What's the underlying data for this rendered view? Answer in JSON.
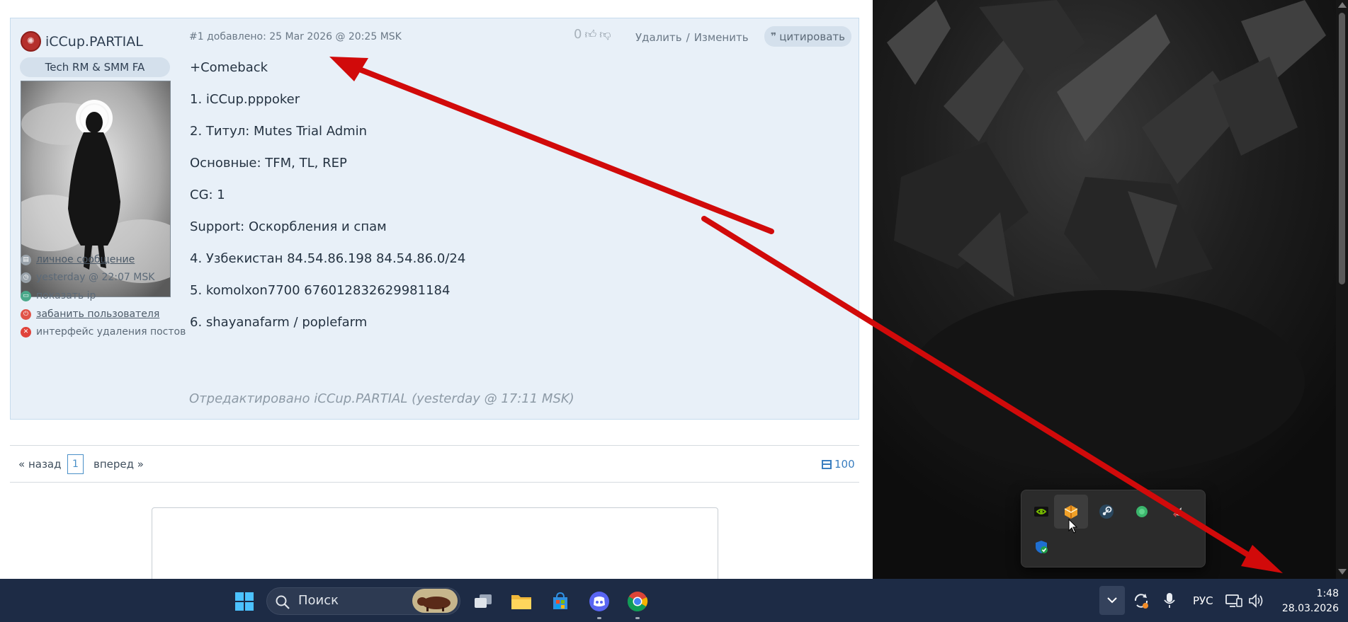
{
  "post": {
    "author": "iCCup.PARTIAL",
    "rank": "Tech RM & SMM FA",
    "header": "#1 добавлено: 25 Mar 2026 @ 20:25 MSK",
    "votes": "0",
    "actions": {
      "delete": "Удалить",
      "sep": "/",
      "edit": "Изменить"
    },
    "quote": "цитировать",
    "body": [
      "+Comeback",
      "1. iCCup.pppoker",
      "2. Титул: Mutes Trial Admin",
      "Основные: TFM, TL, REP",
      "CG: 1",
      "Support: Оскорбления и спам",
      "4. Узбекистан 84.54.86.198 84.54.86.0/24",
      "5. komolxon7700 676012832629981184",
      "6. shayanafarm / poplefarm"
    ],
    "edited": "Отредактировано iCCup.PARTIAL (yesterday @ 17:11 MSK)",
    "meta": {
      "pm": "личное сообщение",
      "last_seen": "yesterday @ 22:07 MSK",
      "show_ip": "показать ip",
      "ban": "забанить пользователя",
      "delete_ui": "интерфейс удаления постов"
    }
  },
  "pager": {
    "prev": "« назад",
    "page": "1",
    "next": "вперед »",
    "per_page": "100"
  },
  "taskbar": {
    "search_placeholder": "Поиск",
    "lang": "РУС",
    "time": "1:48",
    "date": "28.03.2026"
  },
  "colors": {
    "accent": "#4a90c8",
    "post_bg": "#e8f0f8",
    "taskbar": "#1d2b45",
    "arrow": "#d10a0a"
  }
}
